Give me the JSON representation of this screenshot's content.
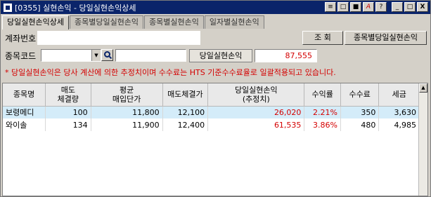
{
  "window": {
    "title": "[0355] 실현손익 - 당일실현손익상세",
    "buttons": [
      "≡",
      "□",
      "■",
      "A",
      "?",
      "_",
      "□",
      "X"
    ]
  },
  "tabs": [
    {
      "label": "당일실현손익상세",
      "active": true
    },
    {
      "label": "종목별당일실현손익",
      "active": false
    },
    {
      "label": "종목별실현손익",
      "active": false
    },
    {
      "label": "일자별실현손익",
      "active": false
    }
  ],
  "account": {
    "label": "계좌번호",
    "query_button": "조 회",
    "by_stock_button": "종목별당일실현손익"
  },
  "stock": {
    "label": "종목코드",
    "code_value": "",
    "name_value": "",
    "profit_label": "당일실현손익",
    "profit_value": "87,555"
  },
  "notice": "* 당일실현손익은 당사 계산에 의한 추정치이며 수수료는 HTS 기준수수료율로 일괄적용되고 있습니다.",
  "table": {
    "headers": [
      "종목명",
      "매도\n체결량",
      "평균\n매입단가",
      "매도체결가",
      "당일실현손익\n(추정치)",
      "수익률",
      "수수료",
      "세금"
    ],
    "rows": [
      [
        "보령메디",
        "100",
        "11,800",
        "12,100",
        "26,020",
        "2.21%",
        "350",
        "3,630"
      ],
      [
        "와이솔",
        "134",
        "11,900",
        "12,400",
        "61,535",
        "3.86%",
        "480",
        "4,985"
      ]
    ]
  },
  "colors": {
    "title_bar": "#0a246a",
    "selected_row": "#d4ecf9",
    "profit_red": "#d40000"
  }
}
